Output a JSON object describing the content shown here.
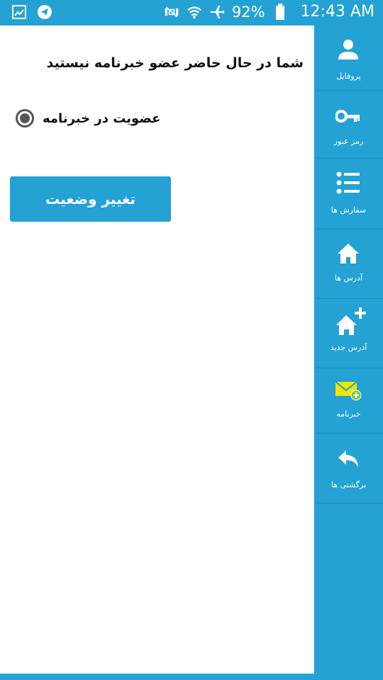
{
  "status_bar": {
    "battery": "92%",
    "time": "12:43 AM",
    "icons": [
      "gallery-icon",
      "telegram-icon",
      "mute-icon",
      "wifi-icon",
      "airplane-icon",
      "battery-icon"
    ]
  },
  "main": {
    "status_message": "شما در حال حاضر عضو خبرنامه نیستید",
    "radio_label": "عضویت در خبرنامه",
    "radio_selected": true,
    "change_button": "تغییر وضعیت"
  },
  "sidebar": {
    "items": [
      {
        "label": "پروفایل",
        "icon": "person-icon"
      },
      {
        "label": "رمز عبور",
        "icon": "key-icon"
      },
      {
        "label": "سفارش ها",
        "icon": "list-icon"
      },
      {
        "label": "آدرس ها",
        "icon": "home-icon"
      },
      {
        "label": "آدرس جدید",
        "icon": "home-plus-icon"
      },
      {
        "label": "خبرنامه",
        "icon": "mail-icon"
      },
      {
        "label": "برگشتی ها",
        "icon": "reply-icon"
      }
    ]
  },
  "colors": {
    "accent": "#23a2d3",
    "mail_icon": "#f0e400",
    "mail_plus": "#7ac943"
  }
}
